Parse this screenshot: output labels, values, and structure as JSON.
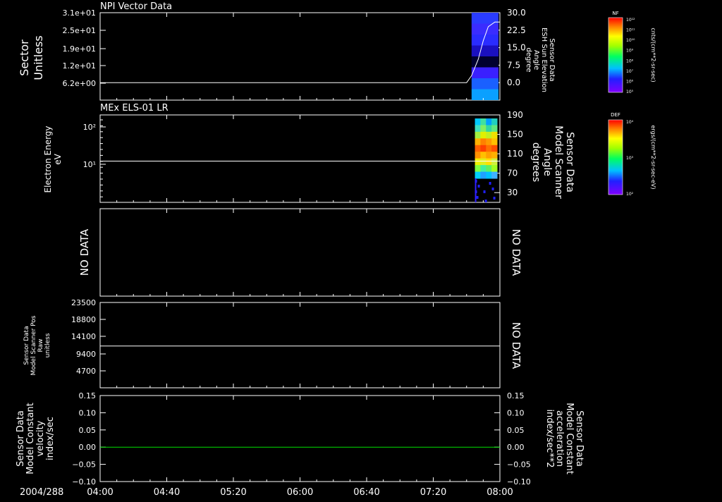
{
  "time_axis": {
    "date_label": "2004/288",
    "ticks": [
      "04:00",
      "04:40",
      "05:20",
      "06:00",
      "06:40",
      "07:20",
      "08:00"
    ]
  },
  "chart_data": [
    {
      "id": "panel1",
      "type": "line",
      "title": "NPI Vector Data",
      "ylabel": [
        "Sector",
        "Unitless"
      ],
      "left_ticks": [
        "3.1e+01",
        "2.5e+01",
        "1.9e+01",
        "1.2e+01",
        "6.2e+00"
      ],
      "right_ticks": [
        "30.0",
        "22.5",
        "15.0",
        "7.5",
        "0.0"
      ],
      "right_label": [
        "Sensor Data",
        "ESH Sun Elevation",
        "Angle",
        "degree"
      ],
      "ylim_right": [
        -7.5,
        30
      ],
      "line_color": "#ffffff",
      "series": [
        {
          "x": [
            "04:00",
            "07:20",
            "07:40",
            "07:43",
            "07:47",
            "07:50",
            "07:53",
            "07:57",
            "08:00"
          ],
          "y": [
            0,
            0,
            0,
            3,
            10,
            18,
            24,
            26,
            26
          ]
        }
      ],
      "spectro_colors": [
        "#2a3cff",
        "#3a2cff",
        "#2a2cff",
        "#1a10c0",
        "#000030",
        "#3a20ff",
        "#1a60ff",
        "#0aa0ff"
      ]
    },
    {
      "id": "panel2",
      "type": "heatmap",
      "title": "MEx ELS-01 LR",
      "ylabel": [
        "Electron Energy",
        "eV"
      ],
      "left_ticks": [
        "10²",
        "10¹"
      ],
      "right_ticks": [
        "190",
        "150",
        "110",
        "70",
        "30"
      ],
      "right_label": [
        "Sensor Data",
        "Model Scanner",
        "Angle",
        "degrees"
      ],
      "line_value_deg": 95,
      "line_color": "#ffffff"
    },
    {
      "id": "panel3",
      "type": "line",
      "no_data_left": "NO DATA",
      "no_data_right": "NO DATA"
    },
    {
      "id": "panel4",
      "type": "line",
      "ylabel": [
        "Sensor Data",
        "Model Scanner Pos",
        "Raw",
        "unitless"
      ],
      "left_ticks": [
        "23500",
        "18800",
        "14100",
        "9400",
        "4700"
      ],
      "ylim": [
        0,
        23500
      ],
      "constant_value": 11500,
      "line_color": "#ffffff",
      "no_data_right": "NO DATA"
    },
    {
      "id": "panel5",
      "type": "line",
      "ylabel": [
        "Sensor Data",
        "Model Constant",
        "velocity",
        "index/sec"
      ],
      "left_ticks": [
        "0.15",
        "0.10",
        "0.05",
        "0.00",
        "−0.05",
        "−0.10"
      ],
      "right_ticks": [
        "0.15",
        "0.10",
        "0.05",
        "0.00",
        "−0.05",
        "−0.10"
      ],
      "right_label": [
        "Sensor Data",
        "Model Constant",
        "acceleration",
        "index/sec**2"
      ],
      "ylim": [
        -0.1,
        0.15
      ],
      "constant_value": 0.0,
      "line_color": "#00e000",
      "right_label_color": "#00e000"
    }
  ],
  "colorbars": [
    {
      "title": "NF",
      "ticks": [
        "10¹²",
        "10¹¹",
        "10¹⁰",
        "10⁹",
        "10⁸",
        "10⁷",
        "10⁶",
        "10⁵"
      ],
      "unit": "cnts/(cm**2-sr-sec)"
    },
    {
      "title": "DEF",
      "ticks": [
        "10⁴",
        "10³",
        "10²"
      ],
      "unit": "ergs/(cm**2-sr-sec-eV)"
    }
  ]
}
